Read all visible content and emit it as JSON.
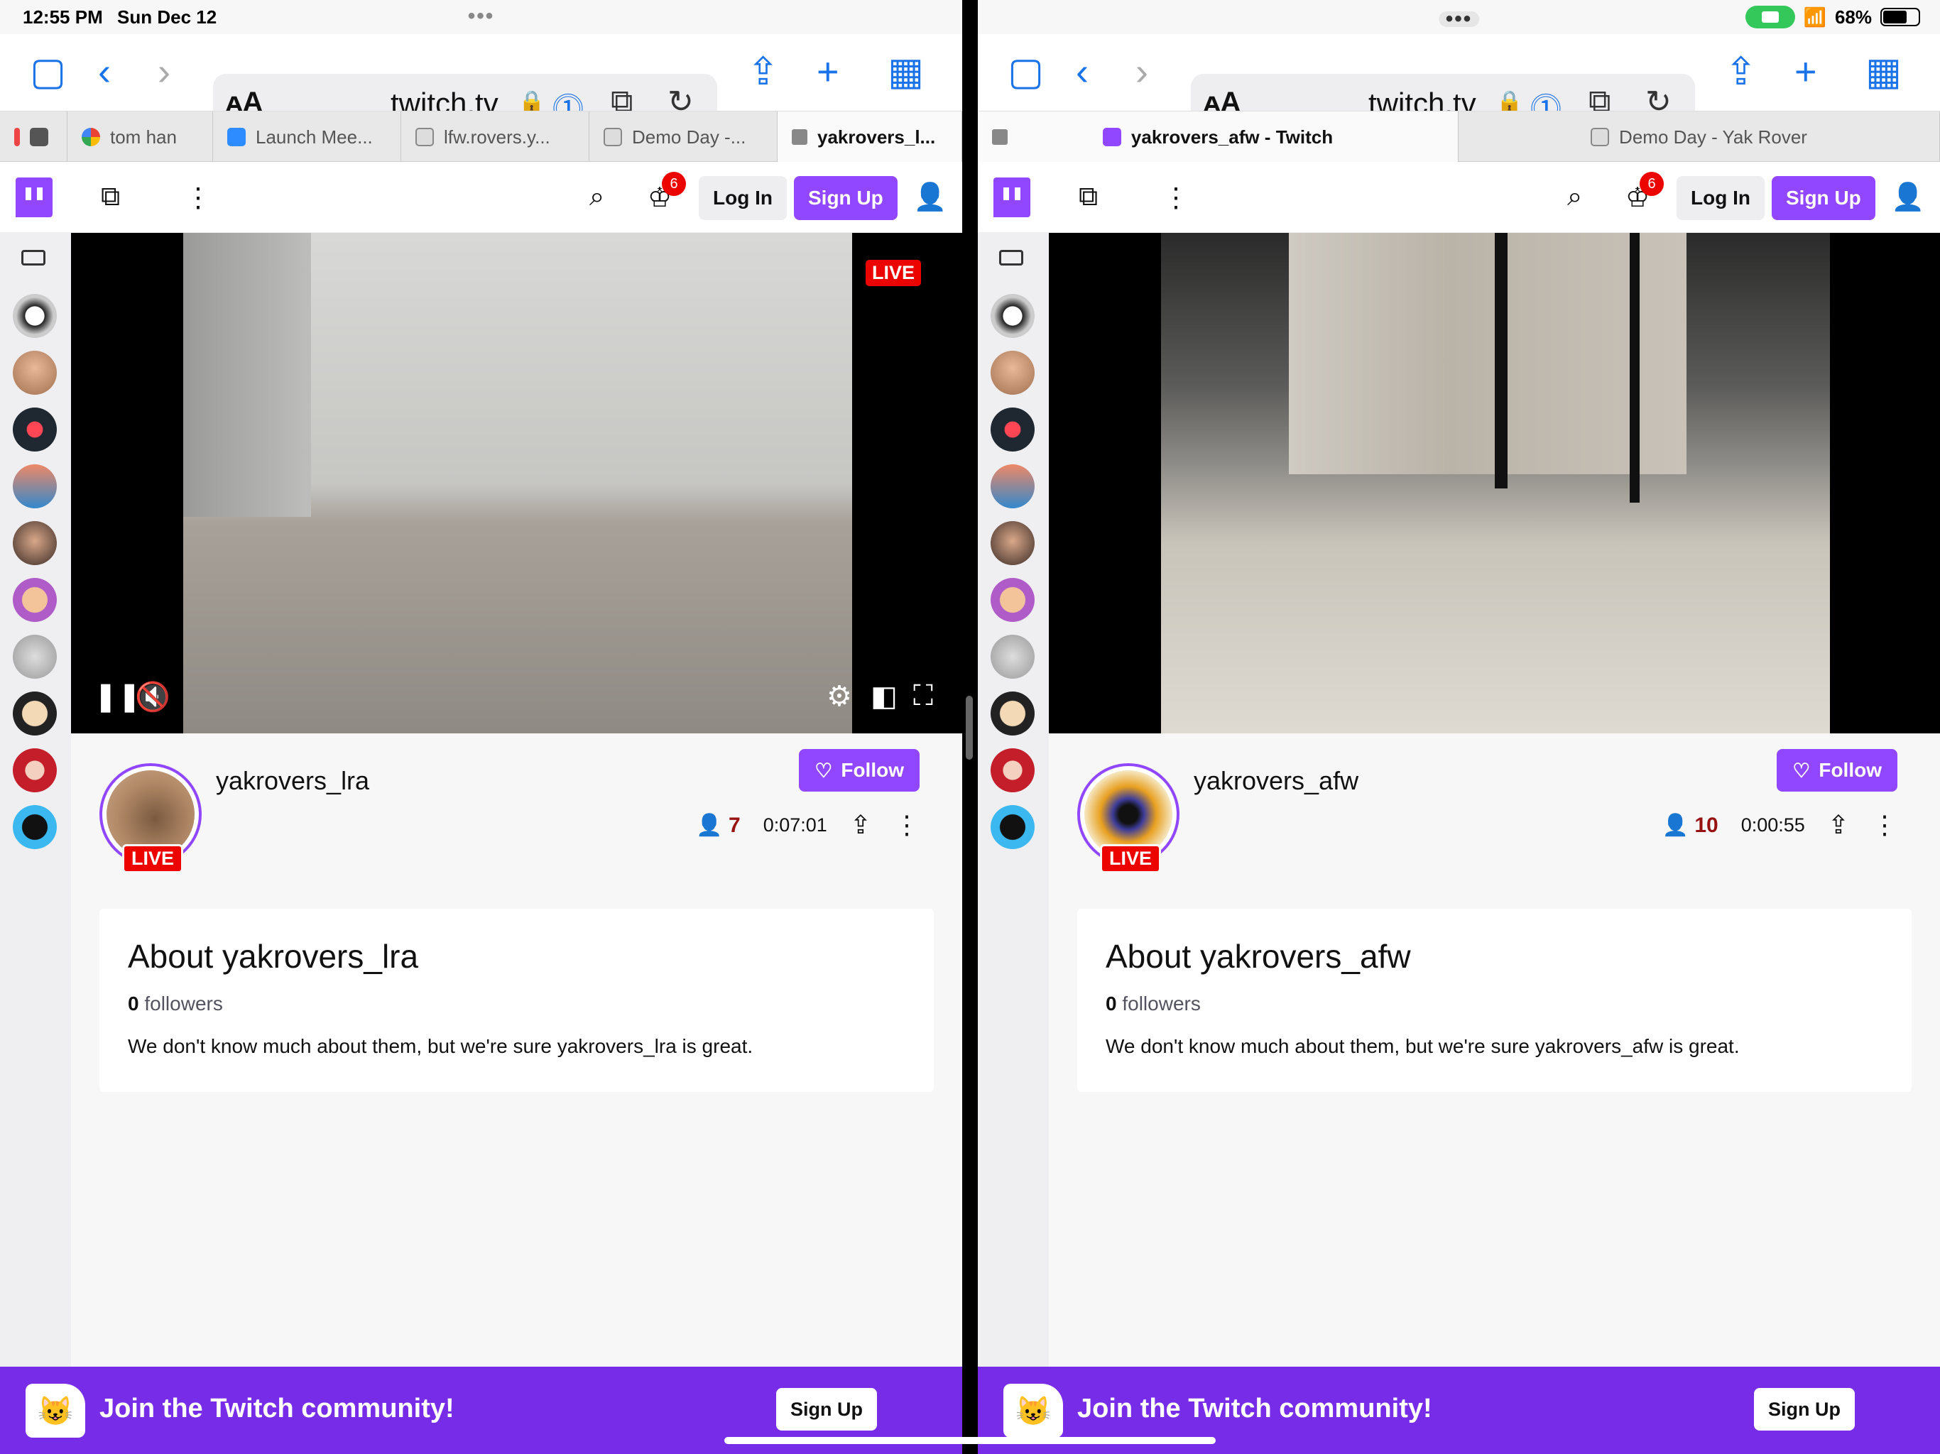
{
  "status": {
    "time": "12:55 PM",
    "date": "Sun Dec 12",
    "battery": "68%",
    "battery_level": 0.68
  },
  "left": {
    "url": "twitch.tv",
    "tabs": [
      {
        "label": ""
      },
      {
        "label": "tom han"
      },
      {
        "label": "Launch Mee..."
      },
      {
        "label": "lfw.rovers.y..."
      },
      {
        "label": "Demo Day -..."
      },
      {
        "label": "yakrovers_l..."
      }
    ],
    "notif_count": "6",
    "login": "Log In",
    "signup": "Sign Up",
    "live": "LIVE",
    "channel": "yakrovers_lra",
    "follow": "Follow",
    "viewers": "7",
    "uptime": "0:07:01",
    "about_title": "About yakrovers_lra",
    "followers_count": "0",
    "followers_label": "followers",
    "about_desc": "We don't know much about them, but we're sure yakrovers_lra is great.",
    "banner_text": "Join the Twitch community!",
    "banner_button": "Sign Up"
  },
  "right": {
    "url": "twitch.tv",
    "tabs": [
      {
        "label": "yakrovers_afw - Twitch"
      },
      {
        "label": "Demo Day - Yak Rover"
      }
    ],
    "notif_count": "6",
    "login": "Log In",
    "signup": "Sign Up",
    "live": "LIVE",
    "channel": "yakrovers_afw",
    "follow": "Follow",
    "viewers": "10",
    "uptime": "0:00:55",
    "about_title": "About yakrovers_afw",
    "followers_count": "0",
    "followers_label": "followers",
    "about_desc": "We don't know much about them, but we're sure yakrovers_afw is great.",
    "banner_text": "Join the Twitch community!",
    "banner_button": "Sign Up"
  },
  "colors": {
    "twitch_purple": "#9146ff",
    "live_red": "#eb0400",
    "banner_purple": "#772ce8",
    "safari_blue": "#1a73e8"
  }
}
